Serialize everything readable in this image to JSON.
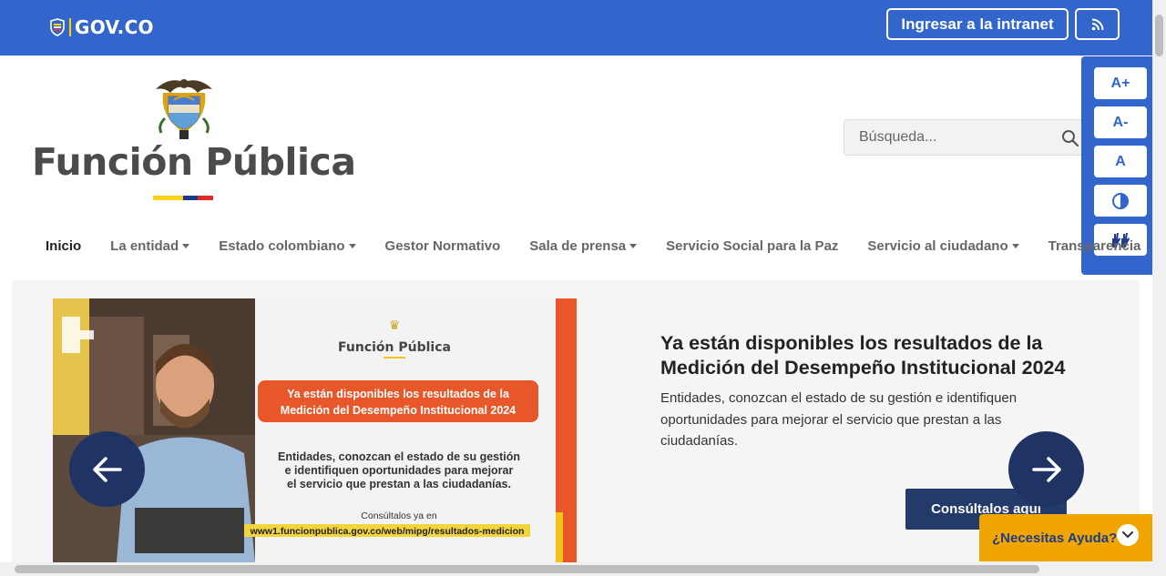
{
  "govbar": {
    "logo_text": "GOV.CO",
    "intranet_button": "Ingresar a la intranet",
    "rss_icon": "rss-icon",
    "color": "#3366cc"
  },
  "header": {
    "brand_title": "Función Pública",
    "search_placeholder": "Búsqueda..."
  },
  "accessibility": {
    "increase_font": "A+",
    "decrease_font": "A-",
    "reset_font": "A",
    "contrast_icon": "contrast-icon",
    "sign_language_icon": "sign-language-icon"
  },
  "nav": {
    "items": [
      {
        "label": "Inicio"
      },
      {
        "label": "La entidad"
      },
      {
        "label": "Estado colombiano"
      },
      {
        "label": "Gestor Normativo"
      },
      {
        "label": "Sala de prensa"
      },
      {
        "label": "Servicio Social para la Paz"
      },
      {
        "label": "Servicio al ciudadano"
      },
      {
        "label": "Transparencia"
      }
    ]
  },
  "carousel": {
    "image": {
      "logo_text": "Función Pública",
      "headline_line1": "Ya están disponibles los resultados de la",
      "headline_line2": "Medición del Desempeño Institucional 2024",
      "body_line1": "Entidades, conozcan el estado de su gestión",
      "body_line2": "e identifiquen oportunidades para mejorar",
      "body_line3": "el servicio que prestan a las ciudadanías.",
      "consult_label": "Consúltalos ya en",
      "url": "www1.funcionpublica.gov.co/web/mipg/resultados-medicion"
    },
    "title": "Ya están disponibles los resultados de la Medición del Desempeño Institucional 2024",
    "description": "Entidades, conozcan el estado de su gestión e identifiquen oportunidades para mejorar el servicio que prestan a las ciudadanías.",
    "cta": "Consúltalos aquí",
    "prev_icon": "arrow-left-icon",
    "next_icon": "arrow-right-icon"
  },
  "help": {
    "label": "¿Necesitas Ayuda?"
  },
  "colors": {
    "primary": "#3366cc",
    "navy": "#1f3464",
    "help": "#f0a500",
    "orange": "#e8572a"
  }
}
